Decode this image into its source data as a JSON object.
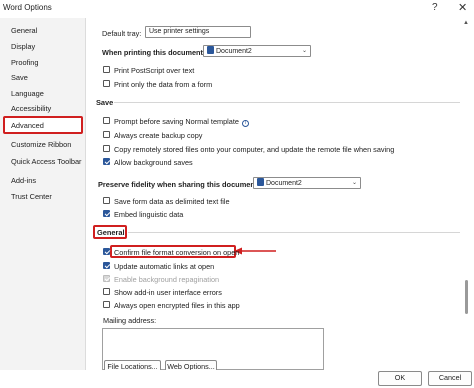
{
  "window": {
    "title": "Word Options",
    "help_icon": "?",
    "close_icon": "✕"
  },
  "sidebar": {
    "items": [
      {
        "label": "General"
      },
      {
        "label": "Display"
      },
      {
        "label": "Proofing"
      },
      {
        "label": "Save"
      },
      {
        "label": "Language"
      },
      {
        "label": "Accessibility"
      },
      {
        "label": "Advanced",
        "selected": true
      },
      {
        "label": "Customize Ribbon"
      },
      {
        "label": "Quick Access Toolbar"
      },
      {
        "label": "Add-ins"
      },
      {
        "label": "Trust Center"
      }
    ]
  },
  "print": {
    "default_tray_label": "Default tray:",
    "default_tray_value": "Use printer settings",
    "when_printing_label": "When printing this document:",
    "document_value": "Document2",
    "options": [
      {
        "label": "Print PostScript over text",
        "checked": false
      },
      {
        "label": "Print only the data from a form",
        "checked": false
      }
    ]
  },
  "save": {
    "heading": "Save",
    "options": [
      {
        "label": "Prompt before saving Normal template",
        "checked": false,
        "info": true
      },
      {
        "label": "Always create backup copy",
        "checked": false
      },
      {
        "label": "Copy remotely stored files onto your computer, and update the remote file when saving",
        "checked": false
      },
      {
        "label": "Allow background saves",
        "checked": true
      }
    ]
  },
  "fidelity": {
    "heading": "Preserve fidelity when sharing this document:",
    "document_value": "Document2",
    "options": [
      {
        "label": "Save form data as delimited text file",
        "checked": false
      },
      {
        "label": "Embed linguistic data",
        "checked": true
      }
    ]
  },
  "general": {
    "heading": "General",
    "options": [
      {
        "label": "Confirm file format conversion on open",
        "checked": true
      },
      {
        "label": "Update automatic links at open",
        "checked": true
      },
      {
        "label": "Enable background repagination",
        "checked": true,
        "disabled": true
      },
      {
        "label": "Show add-in user interface errors",
        "checked": false
      },
      {
        "label": "Always open encrypted files in this app",
        "checked": false
      }
    ],
    "mailing_address_label": "Mailing address:",
    "mailing_address_value": "",
    "file_locations_button": "File Locations...",
    "web_options_button": "Web Options..."
  },
  "footer": {
    "ok_label": "OK",
    "cancel_label": "Cancel"
  },
  "colors": {
    "highlight_red": "#d01f1f",
    "check_blue": "#2b579a"
  }
}
